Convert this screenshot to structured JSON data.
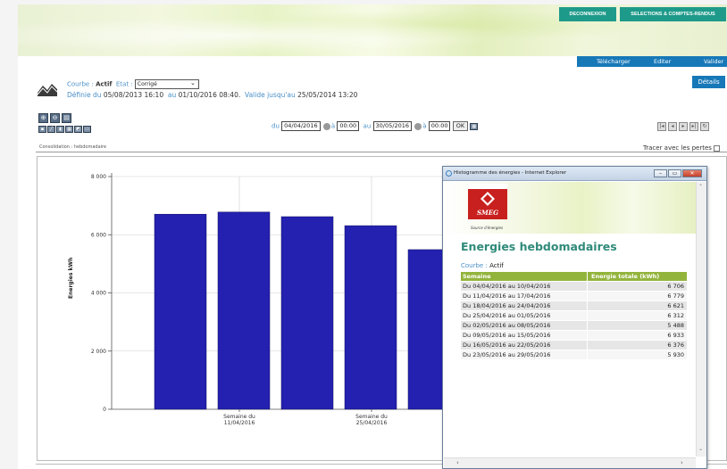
{
  "header": {
    "deconnexion_label": "DECONNEXION",
    "selections_label": "SELECTIONS & COMPTES-RENDUS",
    "telecharger_label": "Télécharger",
    "editer_label": "Editer",
    "valider_label": "Valider",
    "details_label": "Détails"
  },
  "courbe": {
    "courbe_label": "Courbe :",
    "courbe_value": "Actif",
    "etat_label": "Etat :",
    "etat_value": "Corrigé",
    "definie_label": "Définie du",
    "definie_from": "05/08/2013 16:10",
    "au_label": "au",
    "definie_to": "01/10/2016 08:40.",
    "valide_label": "Valide jusqu'au",
    "valide_until": "25/05/2014 13:20"
  },
  "period": {
    "du_label": "du",
    "from_date": "04/04/2016",
    "a_label": "à",
    "from_time": "00:00",
    "au_label": "au",
    "to_date": "30/05/2016",
    "a2_label": "à",
    "to_time": "00:00",
    "ok_label": "OK"
  },
  "consolidation": "Consolidation : hebdomadaire",
  "tracer_label": "Tracer avec les pertes",
  "chart_data": {
    "type": "bar",
    "ylabel": "Energies kWh",
    "ylim": [
      0,
      8000
    ],
    "yticks": [
      "8 000",
      "6 000",
      "4 000",
      "2 000",
      "0"
    ],
    "xtick_labels": [
      {
        "line1": "Semaine du",
        "line2": "11/04/2016"
      },
      {
        "line1": "Semaine du",
        "line2": "25/04/2016"
      }
    ],
    "values": [
      6706,
      6779,
      6621,
      6312,
      5488
    ],
    "bar_color": "#2420b0",
    "grid": true
  },
  "popup": {
    "title": "Histogramme des énergies - Internet Explorer",
    "logo_text": "SMEG",
    "logo_tagline": "Source d'énergies",
    "heading": "Energies hebdomadaires",
    "courbe_label": "Courbe :",
    "courbe_value": "Actif",
    "table": {
      "headers": [
        "Semaine",
        "Energie totale (kWh)"
      ],
      "rows": [
        [
          "Du 04/04/2016 au 10/04/2016",
          "6 706"
        ],
        [
          "Du 11/04/2016 au 17/04/2016",
          "6 779"
        ],
        [
          "Du 18/04/2016 au 24/04/2016",
          "6 621"
        ],
        [
          "Du 25/04/2016 au 01/05/2016",
          "6 312"
        ],
        [
          "Du 02/05/2016 au 08/05/2016",
          "5 488"
        ],
        [
          "Du 09/05/2016 au 15/05/2016",
          "6 933"
        ],
        [
          "Du 16/05/2016 au 22/05/2016",
          "6 376"
        ],
        [
          "Du 23/05/2016 au 29/05/2016",
          "5 930"
        ]
      ]
    }
  },
  "colors": {
    "teal": "#1e9a8a",
    "blue": "#1778b8",
    "table_header": "#93b43c",
    "heading": "#2f8a7a"
  },
  "icons": {
    "zoom_in": "zoom-in-icon",
    "zoom_out": "zoom-out-icon",
    "print": "print-icon",
    "calendar": "calendar-icon",
    "window_close": "close-icon"
  }
}
